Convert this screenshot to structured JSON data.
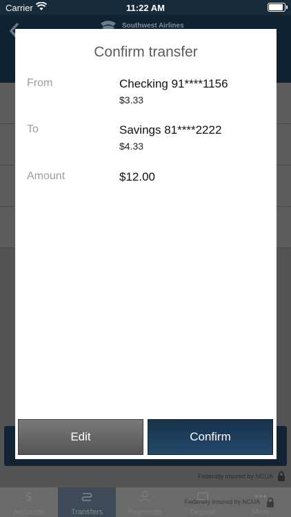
{
  "status_bar": {
    "carrier": "Carrier",
    "time": "11:22 AM"
  },
  "header": {
    "brand": "Southwest Airlines"
  },
  "background": {
    "insured_text": "Federally insured by NCUA"
  },
  "tabs": [
    {
      "label": "Accounts",
      "icon": "dollar-icon"
    },
    {
      "label": "Transfers",
      "icon": "transfer-icon"
    },
    {
      "label": "Payments",
      "icon": "payee-icon"
    },
    {
      "label": "Deposit",
      "icon": "check-deposit-icon"
    },
    {
      "label": "More",
      "icon": "more-icon"
    }
  ],
  "modal": {
    "title": "Confirm transfer",
    "from": {
      "label": "From",
      "account": "Checking 91****1156",
      "balance": "$3.33"
    },
    "to": {
      "label": "To",
      "account": "Savings 81****2222",
      "balance": "$4.33"
    },
    "amount": {
      "label": "Amount",
      "value": "$12.00"
    },
    "edit_label": "Edit",
    "confirm_label": "Confirm"
  },
  "colors": {
    "nav": "#0f2232",
    "confirm": "#1d3d5a",
    "edit": "#666666",
    "overlay": "#5a5a5a"
  }
}
